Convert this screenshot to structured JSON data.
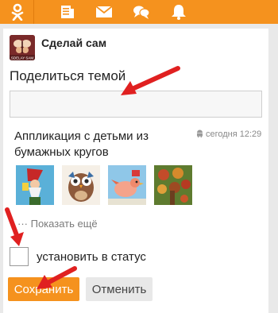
{
  "nav": {
    "icons": [
      "ok-logo-icon",
      "feed-icon",
      "mail-icon",
      "chat-icon",
      "bell-icon"
    ],
    "brand_color": "#f5921e"
  },
  "group": {
    "name": "Сделай сам",
    "avatar_icon": "butterfly-logo-icon",
    "avatar_caption": "SDELAY SAM"
  },
  "share": {
    "title": "Поделиться темой",
    "input_value": "",
    "input_placeholder": ""
  },
  "topic": {
    "title": "Аппликация с детьми из бумажных кругов",
    "time": "сегодня 12:29",
    "platform_icon": "android-icon",
    "thumbnails": [
      "gnome-thumbnail",
      "owl-thumbnail",
      "bird-thumbnail",
      "tree-thumbnail"
    ]
  },
  "show_more": "··· Показать ещё",
  "status_option": {
    "label": "установить в статус",
    "checked": false
  },
  "buttons": {
    "save": "Сохранить",
    "cancel": "Отменить"
  },
  "annotation_color": "#e02020"
}
